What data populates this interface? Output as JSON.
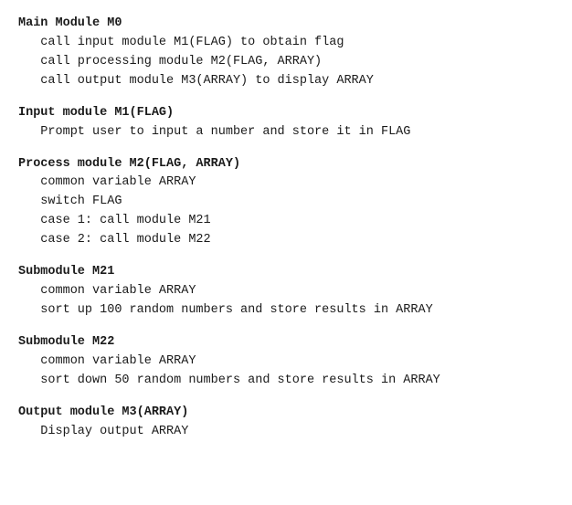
{
  "sections": [
    {
      "id": "main-module",
      "header": "Main Module M0",
      "lines": [
        "   call input module M1(FLAG) to obtain flag",
        "   call processing module M2(FLAG, ARRAY)",
        "   call output module M3(ARRAY) to display ARRAY"
      ]
    },
    {
      "id": "input-module",
      "header": "Input module M1(FLAG)",
      "lines": [
        "   Prompt user to input a number and store it in FLAG"
      ]
    },
    {
      "id": "process-module",
      "header": "Process module M2(FLAG, ARRAY)",
      "lines": [
        "   common variable ARRAY",
        "   switch FLAG",
        "   case 1: call module M21",
        "   case 2: call module M22"
      ]
    },
    {
      "id": "submodule-m21",
      "header": "Submodule M21",
      "lines": [
        "   common variable ARRAY",
        "   sort up 100 random numbers and store results in ARRAY"
      ]
    },
    {
      "id": "submodule-m22",
      "header": "Submodule M22",
      "lines": [
        "   common variable ARRAY",
        "   sort down 50 random numbers and store results in ARRAY"
      ]
    },
    {
      "id": "output-module",
      "header": "Output module M3(ARRAY)",
      "lines": [
        "   Display output ARRAY"
      ]
    }
  ]
}
